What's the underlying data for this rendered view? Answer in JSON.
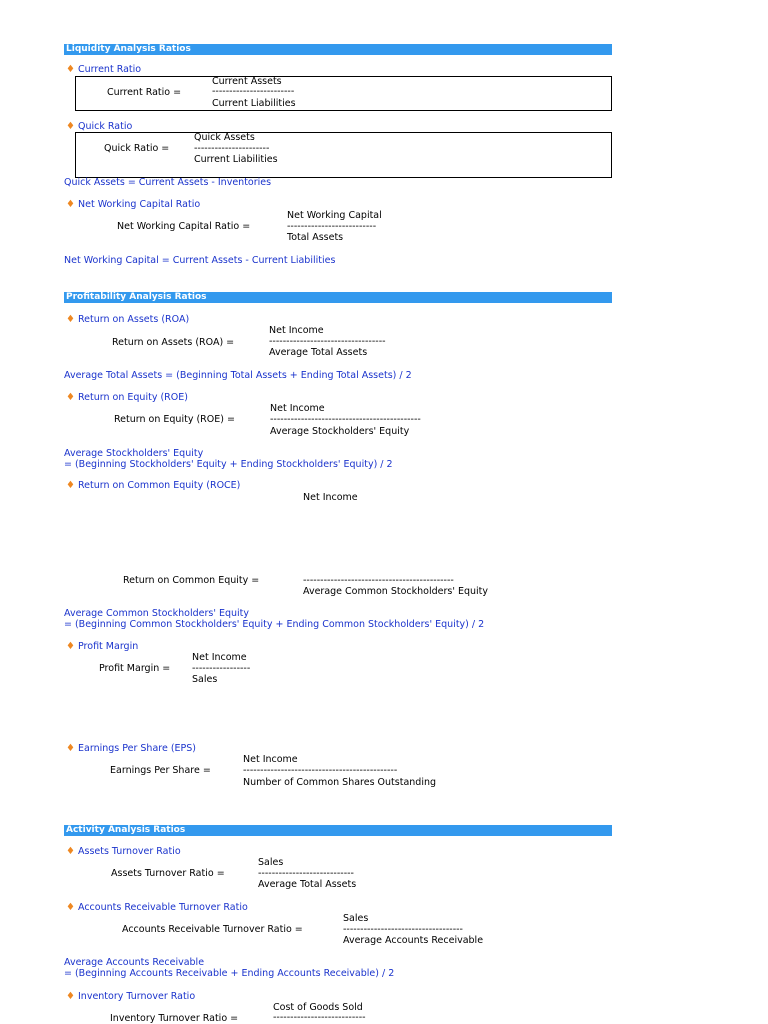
{
  "bullet": "♦",
  "sections": {
    "liquidity": "Liquidity Analysis Ratios",
    "profitability": "Profitability Analysis Ratios",
    "activity": "Activity Analysis Ratios"
  },
  "current_ratio": {
    "heading": "Current Ratio",
    "label": "Current Ratio =",
    "numerator": "Current Assets",
    "divider": "------------------------",
    "denominator": "Current Liabilities"
  },
  "quick_ratio": {
    "heading": "Quick Ratio",
    "label": "Quick Ratio =",
    "numerator": "Quick Assets",
    "divider": "----------------------",
    "denominator": "Current Liabilities",
    "note": "Quick Assets = Current Assets - Inventories"
  },
  "nwc_ratio": {
    "heading": "Net Working Capital Ratio",
    "label": "Net Working Capital Ratio =",
    "numerator": "Net Working Capital",
    "divider": "--------------------------",
    "denominator": "Total Assets",
    "note": "Net Working Capital = Current Assets - Current Liabilities"
  },
  "roa": {
    "heading": "Return on Assets (ROA)",
    "label": "Return on Assets (ROA) =",
    "numerator": "Net Income",
    "divider": "----------------------------------",
    "denominator": "Average Total Assets",
    "note": "Average Total Assets = (Beginning Total Assets + Ending Total Assets) / 2"
  },
  "roe": {
    "heading": "Return on Equity (ROE)",
    "label": "Return on Equity (ROE) =",
    "numerator": "Net Income",
    "divider": "--------------------------------------------",
    "denominator": "Average Stockholders' Equity",
    "note1": "Average Stockholders' Equity",
    "note2": "= (Beginning Stockholders' Equity + Ending Stockholders' Equity) / 2"
  },
  "roce": {
    "heading": "Return on Common Equity (ROCE)",
    "label": "Return on Common Equity =",
    "numerator": "Net Income",
    "divider": "--------------------------------------------",
    "denominator": "Average Common Stockholders' Equity",
    "note1": "Average Common Stockholders' Equity",
    "note2": "= (Beginning Common Stockholders' Equity + Ending Common Stockholders' Equity) / 2"
  },
  "profit_margin": {
    "heading": "Profit Margin",
    "label": "Profit Margin =",
    "numerator": "Net Income",
    "divider": "-----------------",
    "denominator": "Sales"
  },
  "eps": {
    "heading": "Earnings Per Share (EPS)",
    "label": "Earnings Per Share =",
    "numerator": "Net Income",
    "divider": "---------------------------------------------",
    "denominator": "Number of Common Shares Outstanding"
  },
  "asset_turnover": {
    "heading": "Assets Turnover Ratio",
    "label": "Assets Turnover Ratio =",
    "numerator": "Sales",
    "divider": "----------------------------",
    "denominator": "Average Total Assets"
  },
  "ar_turnover": {
    "heading": "Accounts Receivable Turnover Ratio",
    "label": "Accounts Receivable Turnover Ratio =",
    "numerator": "Sales",
    "divider": "-----------------------------------",
    "denominator": "Average Accounts Receivable",
    "note1": "Average Accounts Receivable",
    "note2": "= (Beginning Accounts Receivable + Ending Accounts Receivable) / 2"
  },
  "inventory_turnover": {
    "heading": "Inventory Turnover Ratio",
    "label": "Inventory Turnover Ratio =",
    "numerator": "Cost of Goods Sold",
    "divider": "---------------------------"
  }
}
